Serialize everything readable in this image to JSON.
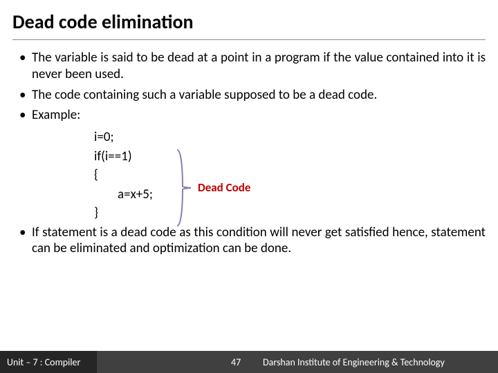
{
  "title": "Dead code elimination",
  "bullets": {
    "b1": "The variable is said to be dead at a point in a program if the value contained into it is never been used.",
    "b2": "The code containing such a variable supposed to be a dead code.",
    "b3": "Example:",
    "b4": "If statement is a dead code as this condition will never get satisfied hence, statement can be eliminated and optimization can be done."
  },
  "code": {
    "l1": "i=0;",
    "l2": "if(i==1)",
    "l3": "{",
    "l4": "a=x+5;",
    "l5": "}"
  },
  "dead_label": "Dead Code",
  "footer": {
    "unit": "Unit – 7 : Compiler",
    "page": "47",
    "institute": "Darshan Institute of Engineering & Technology"
  }
}
